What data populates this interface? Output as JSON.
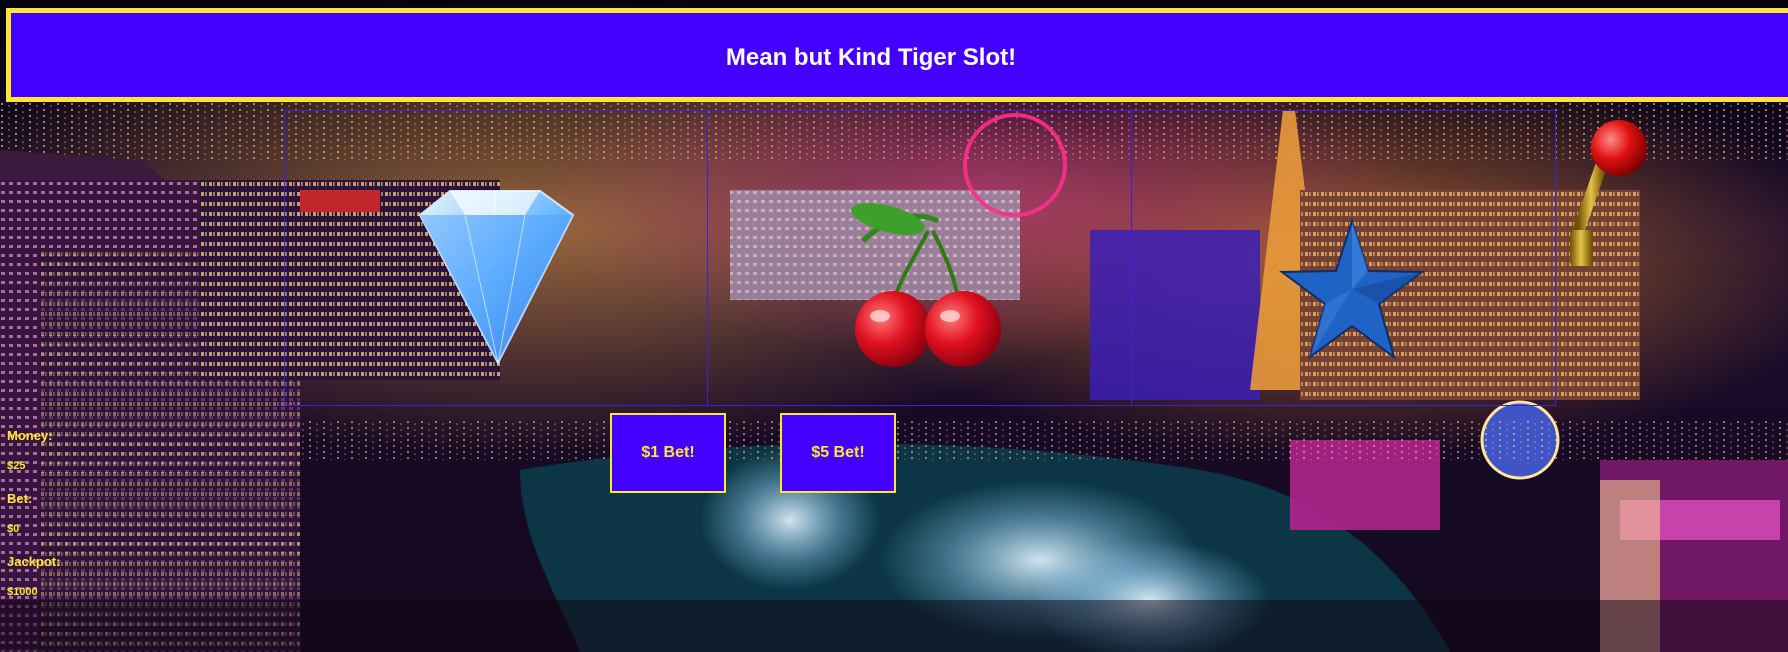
{
  "header": {
    "title": "Mean but Kind Tiger Slot!"
  },
  "reels": [
    {
      "symbol": "diamond-icon"
    },
    {
      "symbol": "cherries-icon"
    },
    {
      "symbol": "star-icon"
    }
  ],
  "lever": {
    "icon": "slot-lever-icon"
  },
  "buttons": {
    "bet1_label": "$1 Bet!",
    "bet5_label": "$5 Bet!"
  },
  "stats": {
    "money_label": "Money:",
    "money_value": "$25",
    "bet_label": "Bet:",
    "bet_value": "$0",
    "jackpot_label": "Jackpot:",
    "jackpot_value": "$1000"
  },
  "colors": {
    "accent_purple": "#4400ff",
    "accent_yellow": "#ffe633",
    "title_white": "#ffffff"
  }
}
